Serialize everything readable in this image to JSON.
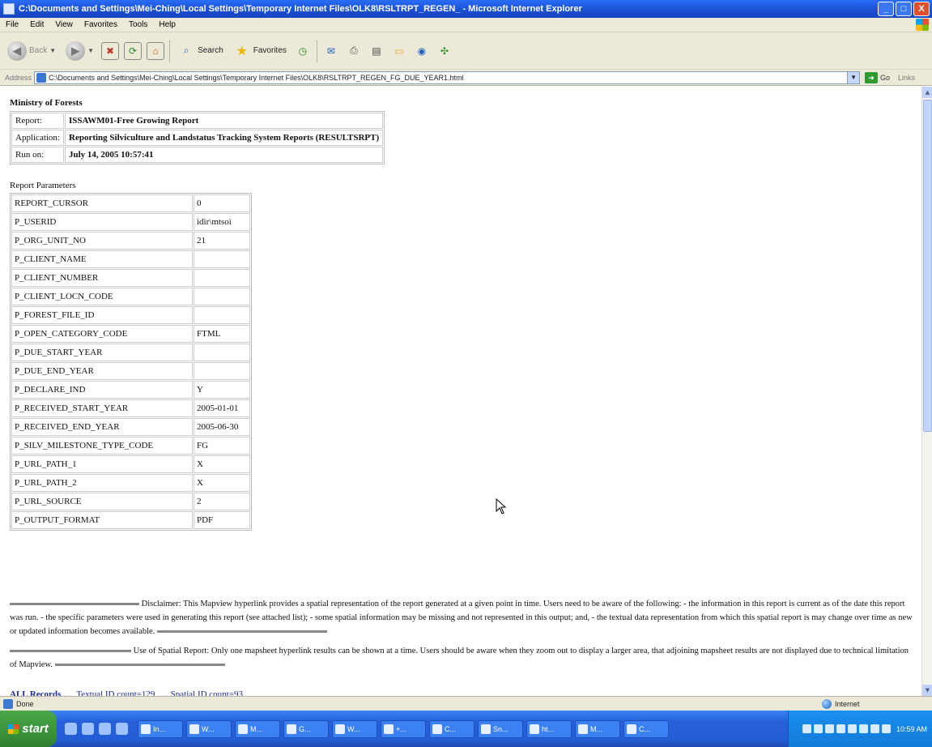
{
  "window": {
    "title": "C:\\Documents and Settings\\Mei-Ching\\Local Settings\\Temporary Internet Files\\OLK8\\RSLTRPT_REGEN_ - Microsoft Internet Explorer",
    "controls": {
      "minimize": "_",
      "maximize": "□",
      "close": "X"
    }
  },
  "menu": [
    "File",
    "Edit",
    "View",
    "Favorites",
    "Tools",
    "Help"
  ],
  "toolbar": {
    "back": "Back",
    "search": "Search",
    "favorites": "Favorites"
  },
  "address": {
    "label": "Address",
    "url": "C:\\Documents and Settings\\Mei-Ching\\Local Settings\\Temporary Internet Files\\OLK8\\RSLTRPT_REGEN_FG_DUE_YEAR1.html",
    "go": "Go",
    "links": "Links"
  },
  "report": {
    "ministry": "Ministry of Forests",
    "header": [
      {
        "key": "Report:",
        "value": "ISSAWM01-Free Growing Report"
      },
      {
        "key": "Application:",
        "value": "Reporting Silviculture and Landstatus Tracking System Reports (RESULTSRPT)"
      },
      {
        "key": "Run on:",
        "value": "July 14, 2005 10:57:41"
      }
    ],
    "params_title": "Report Parameters",
    "params": [
      {
        "key": "REPORT_CURSOR",
        "value": "0"
      },
      {
        "key": "P_USERID",
        "value": "idir\\mtsoi"
      },
      {
        "key": "P_ORG_UNIT_NO",
        "value": "21"
      },
      {
        "key": "P_CLIENT_NAME",
        "value": ""
      },
      {
        "key": "P_CLIENT_NUMBER",
        "value": ""
      },
      {
        "key": "P_CLIENT_LOCN_CODE",
        "value": ""
      },
      {
        "key": "P_FOREST_FILE_ID",
        "value": ""
      },
      {
        "key": "P_OPEN_CATEGORY_CODE",
        "value": "FTML"
      },
      {
        "key": "P_DUE_START_YEAR",
        "value": ""
      },
      {
        "key": "P_DUE_END_YEAR",
        "value": ""
      },
      {
        "key": "P_DECLARE_IND",
        "value": "Y"
      },
      {
        "key": "P_RECEIVED_START_YEAR",
        "value": "2005-01-01"
      },
      {
        "key": "P_RECEIVED_END_YEAR",
        "value": "2005-06-30"
      },
      {
        "key": "P_SILV_MILESTONE_TYPE_CODE",
        "value": "FG"
      },
      {
        "key": "P_URL_PATH_1",
        "value": "X"
      },
      {
        "key": "P_URL_PATH_2",
        "value": "X"
      },
      {
        "key": "P_URL_SOURCE",
        "value": "2"
      },
      {
        "key": "P_OUTPUT_FORMAT",
        "value": "PDF"
      }
    ],
    "disclaimer": "Disclaimer: This Mapview hyperlink provides a spatial representation of the report generated at a given point in time. Users need to be aware of the following: - the information in this report is current as of the date this report was run. - the specific parameters were used in generating this report (see attached list); - some spatial information may be missing and not represented in this output; and, - the textual data representation from which this spatial report is may change over time as new or updated information becomes available.",
    "spatial_note": "Use of Spatial Report: Only one mapsheet hyperlink results can be shown at a time. Users should be aware when they zoom out to display a larger area, that adjoining mapsheet results are not displayed due to technical limitation of Mapview.",
    "records": {
      "all": "ALL Records",
      "sep": ".....",
      "textual": "Textual ID count=129",
      "spatial": "Spatial ID count=93"
    }
  },
  "status": {
    "left": "Done",
    "zone": "Internet"
  },
  "taskbar": {
    "start": "start",
    "tasks": [
      "In...",
      "W...",
      "M...",
      "G...",
      "W...",
      "+...",
      "C...",
      "Sn...",
      "ht...",
      "M...",
      "C..."
    ],
    "clock": "10:59 AM"
  }
}
